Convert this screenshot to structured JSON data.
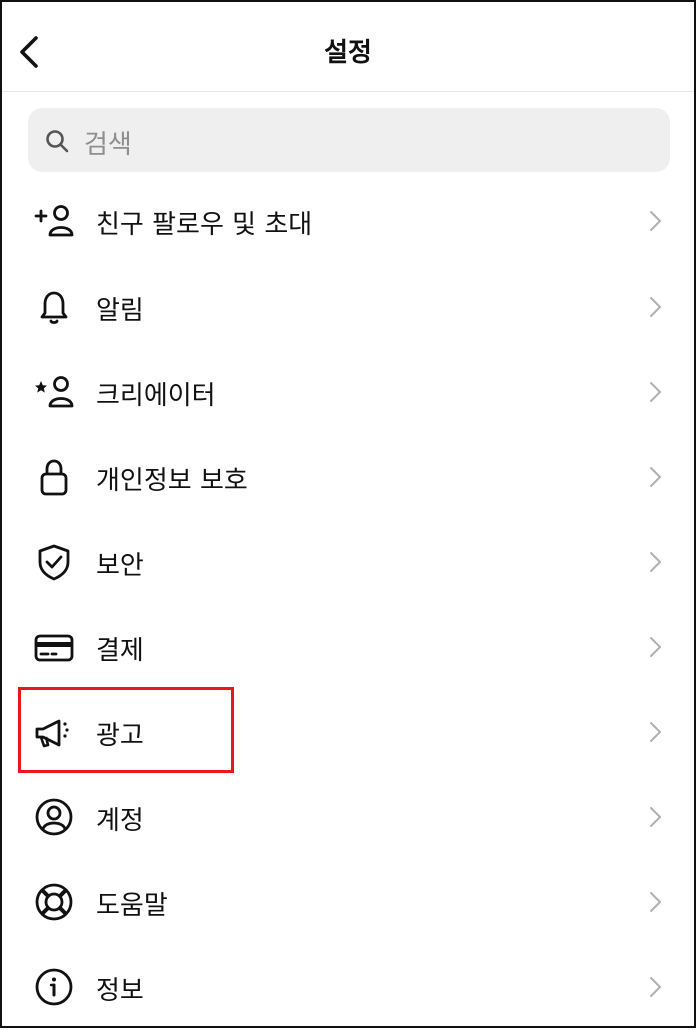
{
  "header": {
    "title": "설정",
    "back_icon": "chevron-left-icon"
  },
  "search": {
    "placeholder": "검색",
    "icon": "search-icon"
  },
  "menu": [
    {
      "id": "friends",
      "label": "친구 팔로우 및 초대",
      "icon": "add-person-icon"
    },
    {
      "id": "notifications",
      "label": "알림",
      "icon": "bell-icon"
    },
    {
      "id": "creator",
      "label": "크리에이터",
      "icon": "star-person-icon"
    },
    {
      "id": "privacy",
      "label": "개인정보 보호",
      "icon": "lock-icon"
    },
    {
      "id": "security",
      "label": "보안",
      "icon": "shield-check-icon"
    },
    {
      "id": "payments",
      "label": "결제",
      "icon": "credit-card-icon"
    },
    {
      "id": "ads",
      "label": "광고",
      "icon": "megaphone-icon"
    },
    {
      "id": "account",
      "label": "계정",
      "icon": "account-circle-icon"
    },
    {
      "id": "help",
      "label": "도움말",
      "icon": "lifebuoy-icon"
    },
    {
      "id": "about",
      "label": "정보",
      "icon": "info-icon"
    }
  ],
  "colors": {
    "highlight": "#e8161f",
    "search_bg": "#efefef",
    "chevron": "#b0b0b0"
  }
}
